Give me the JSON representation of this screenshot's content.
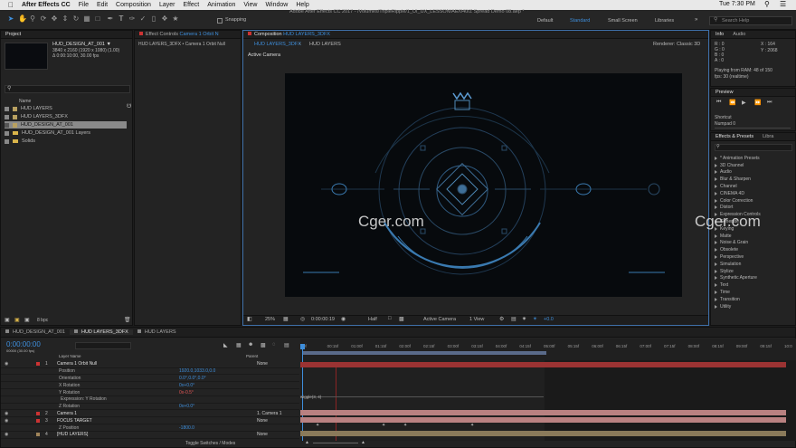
{
  "menubar": {
    "app": "After Effects CC",
    "items": [
      "File",
      "Edit",
      "Composition",
      "Layer",
      "Effect",
      "Animation",
      "View",
      "Window",
      "Help"
    ],
    "clock": "Tue 7:30 PM"
  },
  "toolbar": {
    "title": "Adobe After Effects CC 2017 - /Volumes/TripleRipple/1_UI_UX_LESSON/AE/040/Z Spread Demo 08.aep *",
    "snapping": "Snapping",
    "workspaces": [
      "Default",
      "Standard",
      "Small Screen",
      "Libraries"
    ],
    "active_workspace": "Standard",
    "search_placeholder": "Search Help"
  },
  "project": {
    "tab": "Project",
    "selected_name": "HUD_DESIGN_AT_001 ▼",
    "info_line1": "3840 x 2160  (1920 x 1080) (1.00)",
    "info_line2": "Δ 0:00:10:00, 30.00 fps",
    "col_name": "Name",
    "items": [
      {
        "name": "HUD LAYERS",
        "type": "comp"
      },
      {
        "name": "HUD LAYERS_3DFX",
        "type": "comp"
      },
      {
        "name": "HUD_DESIGN_AT_001",
        "type": "comp"
      },
      {
        "name": "HUD_DESIGN_AT_001 Layers",
        "type": "folder"
      },
      {
        "name": "Solids",
        "type": "folder"
      }
    ],
    "bpc": "8 bpc"
  },
  "effect_controls": {
    "tab_prefix": "Effect Controls",
    "tab_layer": "Camera 1 Orbit N",
    "sub": "HUD LAYERS_3DFX • Camera 1 Orbit Null"
  },
  "composition": {
    "tab_prefix": "Composition",
    "tab_name": "HUD LAYERS_3DFX",
    "subtabs": [
      "HUD LAYERS_3DFX",
      "HUD LAYERS"
    ],
    "renderer": "Renderer:   Classic 3D",
    "active_camera": "Active Camera",
    "zoom": "25%",
    "time": "0:00:00:19",
    "resolution": "Half",
    "view": "Active Camera",
    "views": "1 View",
    "exposure": "+0.0"
  },
  "watermark": "Cger.com",
  "info_panel": {
    "tabs": [
      "Info",
      "Audio"
    ],
    "r": "R : 0",
    "g": "G : 0",
    "b": "B : 0",
    "a": "A : 0",
    "x": "X : 164",
    "y": "Y : 2068",
    "ram1": "Playing from RAM: 48 of 150",
    "ram2": "fps: 30 (realtime)"
  },
  "preview": {
    "tab": "Preview"
  },
  "shortcut": {
    "label": "Shortcut",
    "value": "Numpad 0"
  },
  "effects": {
    "tabs": [
      "Effects & Presets",
      "Libra"
    ],
    "items": [
      "* Animation Presets",
      "3D Channel",
      "Audio",
      "Blur & Sharpen",
      "Channel",
      "CINEMA 4D",
      "Color Correction",
      "Distort",
      "Expression Controls",
      "Generate",
      "Keying",
      "Matte",
      "Noise & Grain",
      "Obsolete",
      "Perspective",
      "Simulation",
      "Stylize",
      "Synthetic Aperture",
      "Text",
      "Time",
      "Transition",
      "Utility"
    ]
  },
  "timeline": {
    "tabs": [
      "HUD_DESIGN_AT_001",
      "HUD LAYERS_3DFX",
      "HUD LAYERS"
    ],
    "active_tab": "HUD LAYERS_3DFX",
    "timecode": "0:00:00:00",
    "timecode_sub": "00000 (30.00 fps)",
    "col_layer": "Layer Name",
    "col_parent": "Parent",
    "ruler": [
      "0f",
      "00:15f",
      "01:00f",
      "01:15f",
      "02:00f",
      "02:15f",
      "03:00f",
      "03:15f",
      "04:00f",
      "04:15f",
      "05:00f",
      "05:15f",
      "06:00f",
      "06:15f",
      "07:00f",
      "07:15f",
      "08:00f",
      "08:15f",
      "09:00f",
      "09:15f",
      "10:0"
    ],
    "rows": [
      {
        "num": "1",
        "name": "Camera 1 Orbit Null",
        "value": "",
        "parent": "None",
        "kind": "layer",
        "color": "#c33"
      },
      {
        "num": "",
        "name": "Position",
        "value": "1920.0,1033.0,0.0",
        "parent": "",
        "kind": "prop"
      },
      {
        "num": "",
        "name": "Orientation",
        "value": "0.0°,0.0°,0.0°",
        "parent": "",
        "kind": "prop"
      },
      {
        "num": "",
        "name": "X Rotation",
        "value": "0x+0.0°",
        "parent": "",
        "kind": "prop"
      },
      {
        "num": "",
        "name": "Y Rotation",
        "value": "0x-0.5°",
        "parent": "",
        "kind": "prop-red"
      },
      {
        "num": "",
        "name": "Expression: Y Rotation",
        "value": "",
        "parent": "",
        "kind": "expr"
      },
      {
        "num": "",
        "name": "Z Rotation",
        "value": "0x+0.0°",
        "parent": "",
        "kind": "prop"
      },
      {
        "num": "2",
        "name": "Camera 1",
        "value": "",
        "parent": "1. Camera 1",
        "kind": "layer",
        "color": "#c33"
      },
      {
        "num": "3",
        "name": "FOCUS TARGET",
        "value": "",
        "parent": "None",
        "kind": "layer",
        "color": "#c33"
      },
      {
        "num": "",
        "name": "Z Position",
        "value": "-1800.0",
        "parent": "",
        "kind": "prop"
      },
      {
        "num": "4",
        "name": "[HUD LAYERS]",
        "value": "",
        "parent": "None",
        "kind": "layer",
        "color": "#a0855a"
      }
    ],
    "expression": "wiggle(3, 4)",
    "toggle": "Toggle Switches / Modes"
  }
}
